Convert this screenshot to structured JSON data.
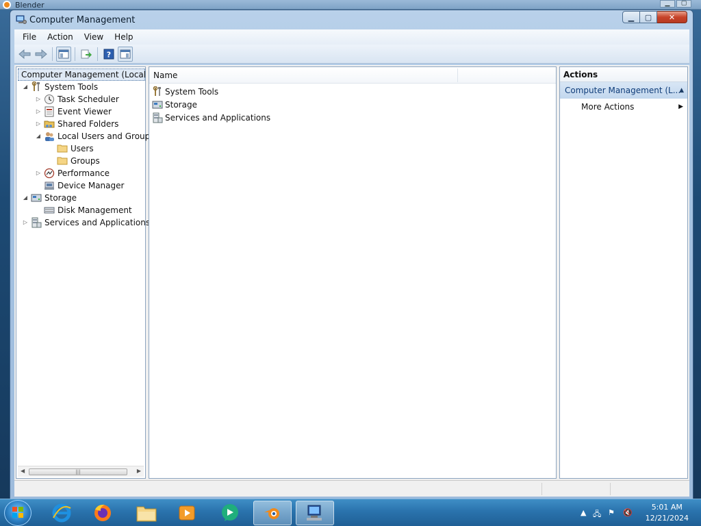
{
  "background_window": {
    "title": "Blender"
  },
  "window": {
    "title": "Computer Management",
    "controls": {
      "minimize": "▁",
      "maximize": "▢",
      "close": "✕"
    }
  },
  "menu": [
    "File",
    "Action",
    "View",
    "Help"
  ],
  "toolbar": {
    "icons": [
      "back-arrow-icon",
      "forward-arrow-icon",
      "show-hide-console-tree-icon",
      "export-list-icon",
      "help-icon",
      "show-hide-action-pane-icon"
    ]
  },
  "tree": {
    "root": "Computer Management (Local",
    "items": [
      {
        "label": "System Tools",
        "expander": "◢"
      },
      {
        "label": "Task Scheduler",
        "expander": "▷"
      },
      {
        "label": "Event Viewer",
        "expander": "▷"
      },
      {
        "label": "Shared Folders",
        "expander": "▷"
      },
      {
        "label": "Local Users and Groups",
        "expander": "◢"
      },
      {
        "label": "Users",
        "expander": ""
      },
      {
        "label": "Groups",
        "expander": ""
      },
      {
        "label": "Performance",
        "expander": "▷"
      },
      {
        "label": "Device Manager",
        "expander": ""
      },
      {
        "label": "Storage",
        "expander": "◢"
      },
      {
        "label": "Disk Management",
        "expander": ""
      },
      {
        "label": "Services and Applications",
        "expander": "▷"
      }
    ]
  },
  "list": {
    "columns": [
      "Name"
    ],
    "rows": [
      "System Tools",
      "Storage",
      "Services and Applications"
    ]
  },
  "actions": {
    "header": "Actions",
    "section": "Computer Management (L...",
    "items": [
      "More Actions"
    ]
  },
  "taskbar": {
    "apps": [
      "internet-explorer-icon",
      "firefox-icon",
      "file-explorer-icon",
      "media-player-icon",
      "chat-app-icon",
      "blender-icon",
      "computer-management-icon"
    ],
    "time": "5:01 AM",
    "date": "12/21/2024"
  }
}
